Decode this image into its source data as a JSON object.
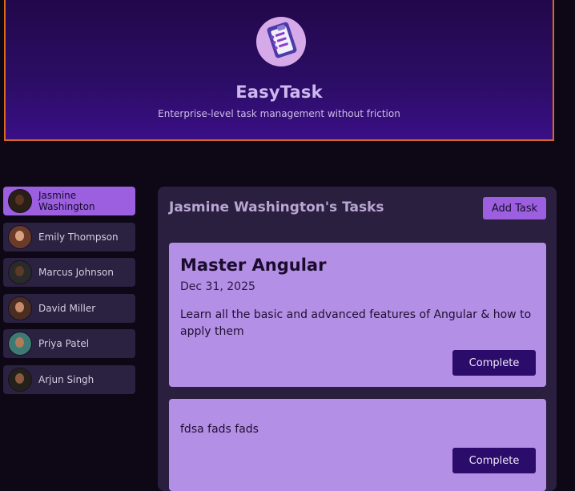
{
  "header": {
    "title": "EasyTask",
    "tagline": "Enterprise-level task management without friction"
  },
  "users": [
    {
      "name": "Jasmine Washington",
      "active": true,
      "skin": "#5a3322"
    },
    {
      "name": "Emily Thompson",
      "active": false,
      "skin": "#d7a27e"
    },
    {
      "name": "Marcus Johnson",
      "active": false,
      "skin": "#5b3a28"
    },
    {
      "name": "David Miller",
      "active": false,
      "skin": "#c8896a"
    },
    {
      "name": "Priya Patel",
      "active": false,
      "skin": "#b27a58"
    },
    {
      "name": "Arjun Singh",
      "active": false,
      "skin": "#8a5a3f"
    }
  ],
  "tasks_panel": {
    "title": "Jasmine Washington's Tasks",
    "add_label": "Add Task",
    "tasks": [
      {
        "title": "Master Angular",
        "date": "Dec 31, 2025",
        "description": "Learn all the basic and advanced features of Angular & how to apply them",
        "complete_label": "Complete"
      },
      {
        "description": "fdsa fads fads",
        "complete_label": "Complete"
      }
    ]
  },
  "colors": {
    "accent": "#9b5fe0",
    "task_card": "#b48fe6",
    "button_dark": "#2b0c6b",
    "header_border": "#d96a1c"
  },
  "icons": {
    "logo": "clipboard-checklist-icon"
  }
}
